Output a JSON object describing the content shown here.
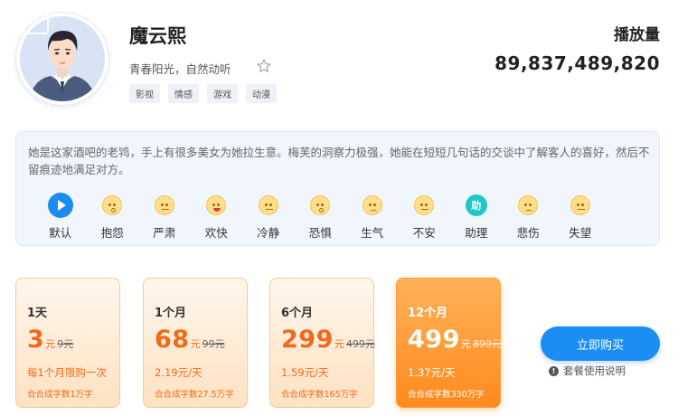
{
  "header": {
    "name": "魔云熙",
    "short_desc": "青春阳光，自然动听",
    "tags": [
      "影视",
      "情感",
      "游戏",
      "动漫"
    ],
    "play_label": "播放量",
    "play_count": "89,837,489,820"
  },
  "description": "她是这家酒吧的老鸨，手上有很多美女为她拉生意。梅芙的洞察力极强，她能在短短几句话的交谈中了解客人的喜好，然后不留痕迹地满足对方。",
  "emotions": [
    {
      "label": "默认",
      "icon": "play-icon"
    },
    {
      "label": "抱怨",
      "icon": "complain-face-icon"
    },
    {
      "label": "严肃",
      "icon": "serious-face-icon"
    },
    {
      "label": "欢快",
      "icon": "happy-face-icon"
    },
    {
      "label": "冷静",
      "icon": "calm-face-icon"
    },
    {
      "label": "恐惧",
      "icon": "fear-face-icon"
    },
    {
      "label": "生气",
      "icon": "angry-face-icon"
    },
    {
      "label": "不安",
      "icon": "uneasy-face-icon"
    },
    {
      "label": "助理",
      "icon": "assistant-icon",
      "icon_text": "助"
    },
    {
      "label": "悲伤",
      "icon": "sad-face-icon"
    },
    {
      "label": "失望",
      "icon": "disappointed-face-icon"
    }
  ],
  "plans": [
    {
      "title": "1天",
      "price": "3",
      "unit": "元",
      "original": "9元",
      "note": "每1个月限购一次",
      "chars": "合合成字数1万字"
    },
    {
      "title": "1个月",
      "price": "68",
      "unit": "元",
      "original": "99元",
      "note": "2.19元/天",
      "chars": "合合成字数27.5万字"
    },
    {
      "title": "6个月",
      "price": "299",
      "unit": "元",
      "original": "499元",
      "note": "1.59元/天",
      "chars": "合合成字数165万字"
    },
    {
      "title": "12个月",
      "price": "499",
      "unit": "元",
      "original": "899元",
      "note": "1.37元/天",
      "chars": "合合成字数330万字"
    }
  ],
  "buy_label": "立即购买",
  "help_label": "套餐使用说明",
  "help_icon_text": "!",
  "colors": {
    "accent_blue": "#1c8ef3",
    "accent_orange": "#ef6a1b",
    "panel_bg": "#f1f6fd"
  }
}
